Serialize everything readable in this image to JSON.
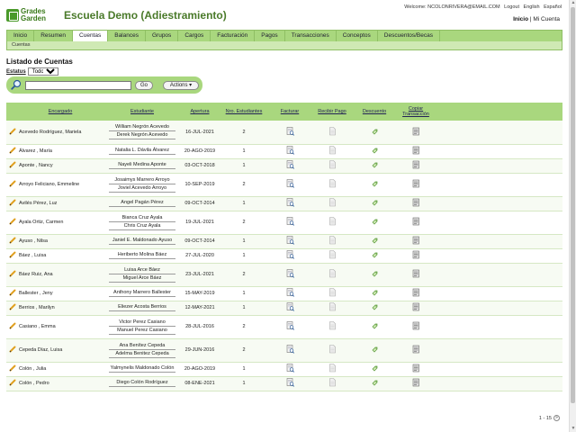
{
  "header": {
    "logo_line1": "Grades",
    "logo_line2": "Garden",
    "school_name": "Escuela Demo (Adiestramiento)",
    "welcome": "Welcome: NCOLONRIVERA@EMAIL.COM",
    "logout": "Logout",
    "lang_en": "English",
    "lang_es": "Español",
    "inicio": "Inicio",
    "separator": "|",
    "mi_cuenta": "Mi Cuenta"
  },
  "nav": {
    "items": [
      "Inicio",
      "Resumen",
      "Cuentas",
      "Balances",
      "Grupos",
      "Cargos",
      "Facturación",
      "Pagos",
      "Transacciones",
      "Conceptos",
      "Descuentos/Becas"
    ],
    "active_index": 2
  },
  "subnav": {
    "label": "Cuentas"
  },
  "list": {
    "title": "Listado de Cuentas",
    "status_label": "Estatus",
    "status_value": "Todos"
  },
  "search": {
    "value": "",
    "go_label": "Go",
    "actions_label": "Actions ▾"
  },
  "table": {
    "headers": {
      "encargado": "Encargado",
      "estudiante": "Estudiante",
      "apertura": "Apertura",
      "nro": "Nro. Estudiantes",
      "facturar": "Facturar",
      "recibir": "Recibir Pago",
      "descuento": "Descuento",
      "copiar1": "Copiar",
      "copiar2": "Transacción"
    },
    "rows": [
      {
        "encargado": "Acevedo Rodríguez, Mariela",
        "students": [
          "William Negrón Acevedo",
          "Derek Negrón Acevedo"
        ],
        "apertura": "16-JUL-2021",
        "nro": "2"
      },
      {
        "encargado": "Álvarez , María",
        "students": [
          "Natalia L. Dávila Álvarez"
        ],
        "apertura": "20-AGO-2019",
        "nro": "1"
      },
      {
        "encargado": "Aponte , Nancy",
        "students": [
          "Nayeli Medina Aponte"
        ],
        "apertura": "03-OCT-2018",
        "nro": "1"
      },
      {
        "encargado": "Arroyo Feliciano, Emmeline",
        "students": [
          "Josaimys Marrero Arroyo",
          "Joviel Acevedo Arroyo"
        ],
        "apertura": "10-SEP-2019",
        "nro": "2"
      },
      {
        "encargado": "Avilés Pérez, Luz",
        "students": [
          "Angel Pagán Pérez"
        ],
        "apertura": "09-OCT-2014",
        "nro": "1"
      },
      {
        "encargado": "Ayala Ortiz, Carmen",
        "students": [
          "Bianca Cruz Ayala",
          "Chris Cruz Ayala"
        ],
        "apertura": "19-JUL-2021",
        "nro": "2"
      },
      {
        "encargado": "Ayuso , Nilsa",
        "students": [
          "Janiel E. Maldonado Ayuso"
        ],
        "apertura": "09-OCT-2014",
        "nro": "1"
      },
      {
        "encargado": "Báez , Luisa",
        "students": [
          "Heriberto Molina Báez"
        ],
        "apertura": "27-JUL-2020",
        "nro": "1"
      },
      {
        "encargado": "Báez Ruiz, Ana",
        "students": [
          "Luisa Arce Báez",
          "Miguel Arce Báez"
        ],
        "apertura": "23-JUL-2021",
        "nro": "2"
      },
      {
        "encargado": "Ballester , Jeny",
        "students": [
          "Anthony Marrero Ballester"
        ],
        "apertura": "15-MAY-2019",
        "nro": "1"
      },
      {
        "encargado": "Berrios , Marilyn",
        "students": [
          "Eliezer Acosta Berrios"
        ],
        "apertura": "12-MAY-2021",
        "nro": "1"
      },
      {
        "encargado": "Casiano , Emma",
        "students": [
          "Victor Perez Casiano",
          "Manuel Perez Casiano"
        ],
        "apertura": "28-JUL-2016",
        "nro": "2"
      },
      {
        "encargado": "Cepeda Díaz, Luisa",
        "students": [
          "Ana Benítez Cepeda",
          "Adelma Benitez Cepeda"
        ],
        "apertura": "29-JUN-2016",
        "nro": "2"
      },
      {
        "encargado": "Colón , Julia",
        "students": [
          "Yalmynelis Maldonado Colón"
        ],
        "apertura": "20-AGO-2019",
        "nro": "1"
      },
      {
        "encargado": "Colón , Pedro",
        "students": [
          "Diego Colón Rodríguez"
        ],
        "apertura": "08-ENE-2021",
        "nro": "1"
      }
    ]
  },
  "pager": {
    "text": "1 - 15",
    "next": "»"
  },
  "colors": {
    "green": "#a9d77e",
    "dark_green": "#4a7a2a",
    "row_alt": "#f7fbf3"
  },
  "icons": [
    "pencil-icon",
    "invoice-icon",
    "payment-icon",
    "discount-icon",
    "copy-icon",
    "search-icon"
  ]
}
